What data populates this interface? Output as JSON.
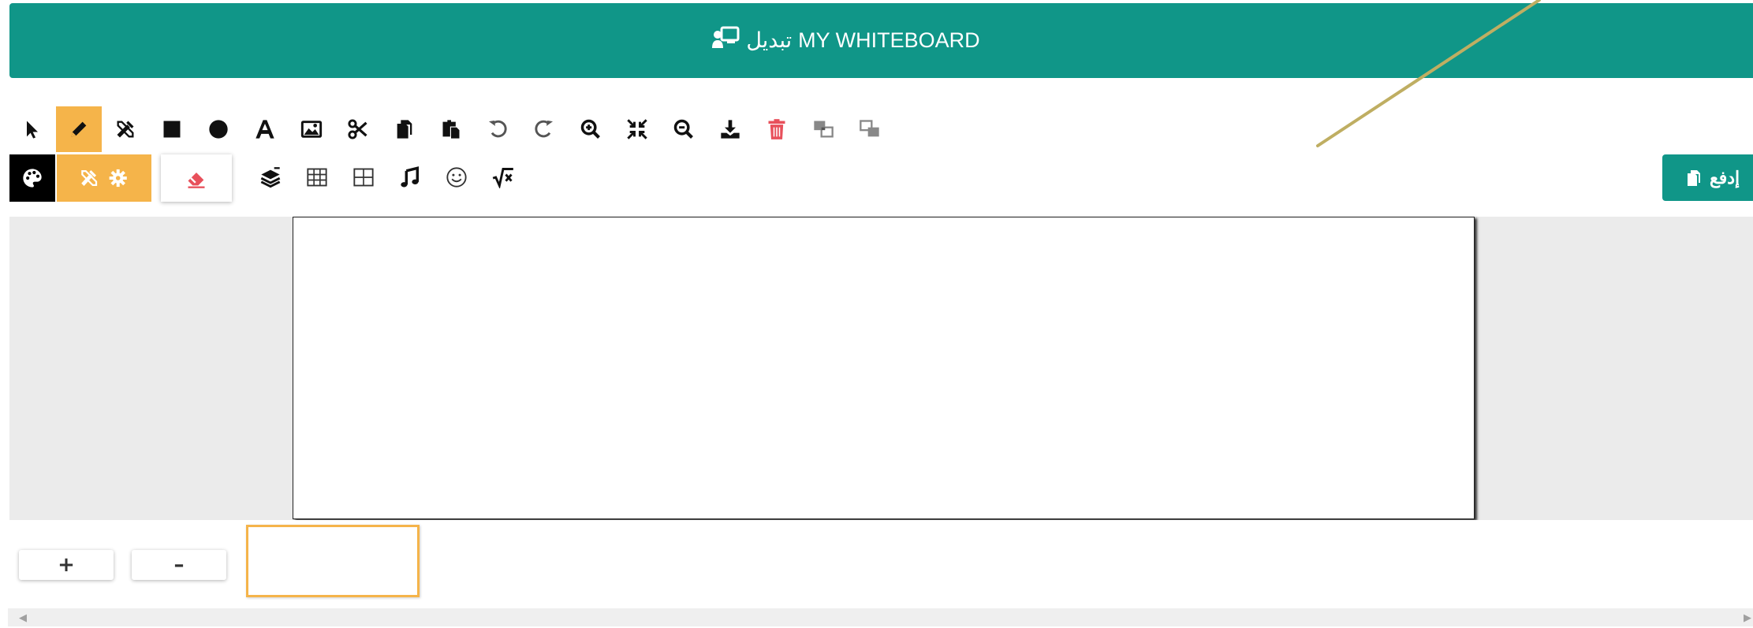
{
  "header": {
    "title": "MY WHITEBOARD",
    "switch_label": "تبديل",
    "switch_icon": "chalkboard-user-icon",
    "background": "#109688"
  },
  "toolbar": {
    "row1": [
      {
        "name": "select-tool",
        "icon": "cursor-arrow-icon"
      },
      {
        "name": "pencil-tool",
        "icon": "pencil-icon",
        "active": true
      },
      {
        "name": "pen-ruler-tool",
        "icon": "pen-ruler-icon"
      },
      {
        "name": "rectangle-tool",
        "icon": "square-icon"
      },
      {
        "name": "circle-tool",
        "icon": "circle-icon"
      },
      {
        "name": "text-tool",
        "icon": "font-a-icon"
      },
      {
        "name": "image-tool",
        "icon": "image-icon"
      },
      {
        "name": "cut-tool",
        "icon": "scissors-icon"
      },
      {
        "name": "copy-tool",
        "icon": "copy-icon"
      },
      {
        "name": "paste-tool",
        "icon": "paste-icon"
      },
      {
        "name": "undo-tool",
        "icon": "undo-icon"
      },
      {
        "name": "redo-tool",
        "icon": "redo-icon"
      },
      {
        "name": "zoom-in-tool",
        "icon": "zoom-in-icon"
      },
      {
        "name": "fit-tool",
        "icon": "compress-icon"
      },
      {
        "name": "zoom-out-tool",
        "icon": "zoom-out-icon"
      },
      {
        "name": "download-tool",
        "icon": "download-icon"
      },
      {
        "name": "delete-tool",
        "icon": "trash-icon"
      },
      {
        "name": "bring-front-tool",
        "icon": "bring-front-icon"
      },
      {
        "name": "send-back-tool",
        "icon": "send-back-icon"
      }
    ],
    "row2": [
      {
        "name": "color-palette-tool",
        "icon": "palette-icon"
      },
      {
        "name": "tool-settings-tool",
        "icon": "ruler-gear-icon"
      },
      {
        "name": "eraser-tool",
        "icon": "eraser-icon"
      },
      {
        "name": "layers-tool",
        "icon": "layers-icon"
      },
      {
        "name": "table-tool",
        "icon": "table-icon"
      },
      {
        "name": "grid-tool",
        "icon": "grid-icon"
      },
      {
        "name": "music-tool",
        "icon": "music-note-icon"
      },
      {
        "name": "emoji-tool",
        "icon": "smiley-icon"
      },
      {
        "name": "math-tool",
        "icon": "square-root-icon"
      }
    ],
    "accent": "#f5b44a",
    "danger": "#e8505b"
  },
  "push_button": {
    "label": "إدفع",
    "icon": "copy-icon"
  },
  "pages": {
    "add_label": "+",
    "remove_label": "–"
  },
  "colors": {
    "stroke": "#bfae62",
    "canvas_bg": "#ebebeb"
  }
}
